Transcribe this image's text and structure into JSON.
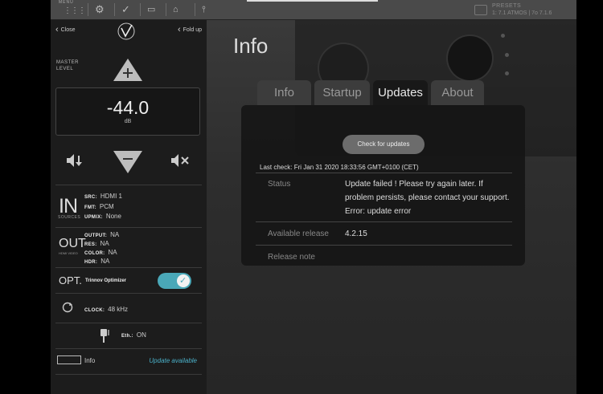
{
  "toolbar": {
    "menu_label": "MENU",
    "preset_label": "PRESETS",
    "preset_value": "1: 7.1 ATMOS | 7o 7.1.6"
  },
  "left_panel": {
    "close_label": "Close",
    "fold_label": "Fold up",
    "master_level_label": "MASTER LEVEL",
    "volume_value": "-44.0",
    "volume_unit": "dB",
    "in_title": "IN",
    "in_subtitle": "SOURCES",
    "src_key": "SRC:",
    "src_val": "HDMI 1",
    "fmt_key": "FMT:",
    "fmt_val": "PCM",
    "upmix_key": "UPMIX:",
    "upmix_val": "None",
    "out_title": "OUT",
    "out_subtitle": "HDMI VIDEO",
    "output_key": "OUTPUT:",
    "output_val": "NA",
    "res_key": "RES:",
    "res_val": "NA",
    "color_key": "COLOR:",
    "color_val": "NA",
    "hdr_key": "HDR:",
    "hdr_val": "NA",
    "opt_title": "OPT.",
    "optimizer_label": "Trinnov Optimizer",
    "optimizer_on": true,
    "clock_key": "CLOCK:",
    "clock_val": "48 kHz",
    "eth_key": "Eth.:",
    "eth_val": "ON",
    "info_label": "Info",
    "update_available": "Update available"
  },
  "main": {
    "title": "Info",
    "tabs": [
      {
        "label": "Info",
        "active": false
      },
      {
        "label": "Startup",
        "active": false
      },
      {
        "label": "Updates",
        "active": true
      },
      {
        "label": "About",
        "active": false
      }
    ],
    "check_button": "Check for updates",
    "last_check": "Last check: Fri Jan 31 2020 18:33:56 GMT+0100 (CET)",
    "status_label": "Status",
    "status_value": "Update failed ! Please try again later. If problem persists, please contact your support. Error: update error",
    "release_label": "Available release",
    "release_value": "4.2.15",
    "note_label": "Release note"
  },
  "colors": {
    "accent": "#4ab0c8",
    "toggle_on": "#4aa8b8"
  }
}
